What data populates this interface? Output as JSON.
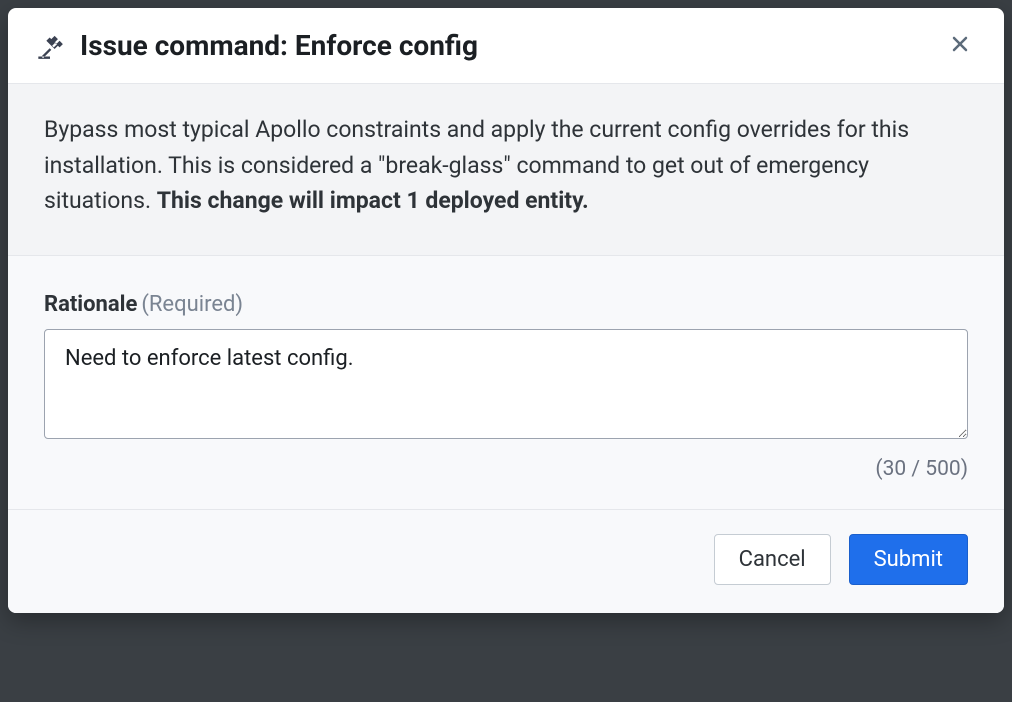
{
  "modal": {
    "title": "Issue command: Enforce config",
    "description_part1": "Bypass most typical Apollo constraints and apply the current config overrides for this installation. This is considered a \"break-glass\" command to get out of emergency situations. ",
    "description_bold": "This change will impact 1 deployed entity.",
    "rationale": {
      "label": "Rationale",
      "required_text": "(Required)",
      "value": "Need to enforce latest config.",
      "char_count": "(30 / 500)"
    },
    "buttons": {
      "cancel": "Cancel",
      "submit": "Submit"
    }
  }
}
